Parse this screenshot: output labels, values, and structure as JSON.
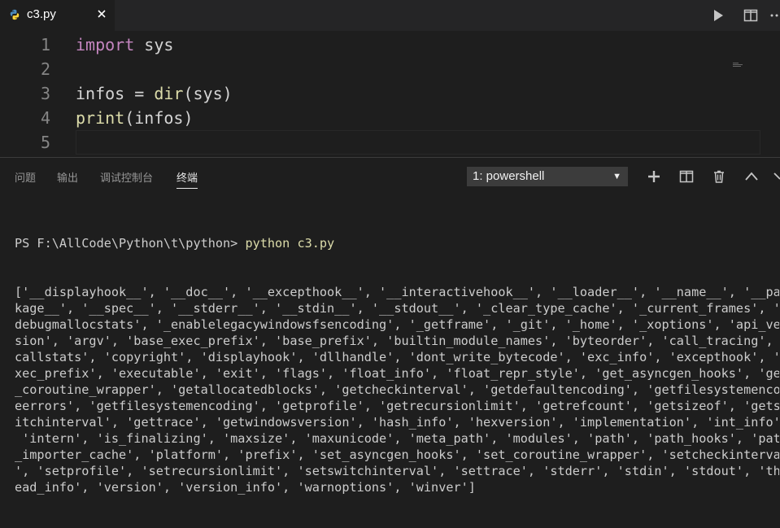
{
  "tab": {
    "filename": "c3.py",
    "icon": "python-file-icon"
  },
  "editor_actions": {
    "run": "play-icon",
    "split": "split-editor-icon",
    "more": "more-icon"
  },
  "editor": {
    "lines": [
      {
        "n": "1",
        "parts": [
          {
            "t": "import",
            "c": "kw"
          },
          {
            "t": " sys",
            "c": ""
          }
        ]
      },
      {
        "n": "2",
        "parts": []
      },
      {
        "n": "3",
        "parts": [
          {
            "t": "infos = ",
            "c": ""
          },
          {
            "t": "dir",
            "c": "fn"
          },
          {
            "t": "(sys)",
            "c": ""
          }
        ]
      },
      {
        "n": "4",
        "parts": [
          {
            "t": "print",
            "c": "fn"
          },
          {
            "t": "(infos)",
            "c": ""
          }
        ]
      },
      {
        "n": "5",
        "parts": []
      }
    ]
  },
  "panel": {
    "tabs": [
      {
        "label": "问题",
        "active": false
      },
      {
        "label": "输出",
        "active": false
      },
      {
        "label": "调试控制台",
        "active": false
      },
      {
        "label": "终端",
        "active": true
      }
    ],
    "terminal_select": "1: powershell",
    "actions": [
      "add-icon",
      "split-terminal-icon",
      "trash-icon",
      "maximize-icon",
      "close-icon"
    ]
  },
  "terminal": {
    "prompt": "PS F:\\AllCode\\Python\\t\\python> ",
    "command": "python c3.py",
    "output": [
      "['__displayhook__', '__doc__', '__excepthook__', '__interactivehook__', '__loader__', '__name__', '__pac",
      "kage__', '__spec__', '__stderr__', '__stdin__', '__stdout__', '_clear_type_cache', '_current_frames', '_",
      "debugmallocstats', '_enablelegacywindowsfsencoding', '_getframe', '_git', '_home', '_xoptions', 'api_ver",
      "sion', 'argv', 'base_exec_prefix', 'base_prefix', 'builtin_module_names', 'byteorder', 'call_tracing', '",
      "callstats', 'copyright', 'displayhook', 'dllhandle', 'dont_write_bytecode', 'exc_info', 'excepthook', 'e",
      "xec_prefix', 'executable', 'exit', 'flags', 'float_info', 'float_repr_style', 'get_asyncgen_hooks', 'get",
      "_coroutine_wrapper', 'getallocatedblocks', 'getcheckinterval', 'getdefaultencoding', 'getfilesystemencod",
      "eerrors', 'getfilesystemencoding', 'getprofile', 'getrecursionlimit', 'getrefcount', 'getsizeof', 'getsw",
      "itchinterval', 'gettrace', 'getwindowsversion', 'hash_info', 'hexversion', 'implementation', 'int_info',",
      " 'intern', 'is_finalizing', 'maxsize', 'maxunicode', 'meta_path', 'modules', 'path', 'path_hooks', 'path",
      "_importer_cache', 'platform', 'prefix', 'set_asyncgen_hooks', 'set_coroutine_wrapper', 'setcheckinterval",
      "', 'setprofile', 'setrecursionlimit', 'setswitchinterval', 'settrace', 'stderr', 'stdin', 'stdout', 'thr",
      "ead_info', 'version', 'version_info', 'warnoptions', 'winver']"
    ]
  }
}
